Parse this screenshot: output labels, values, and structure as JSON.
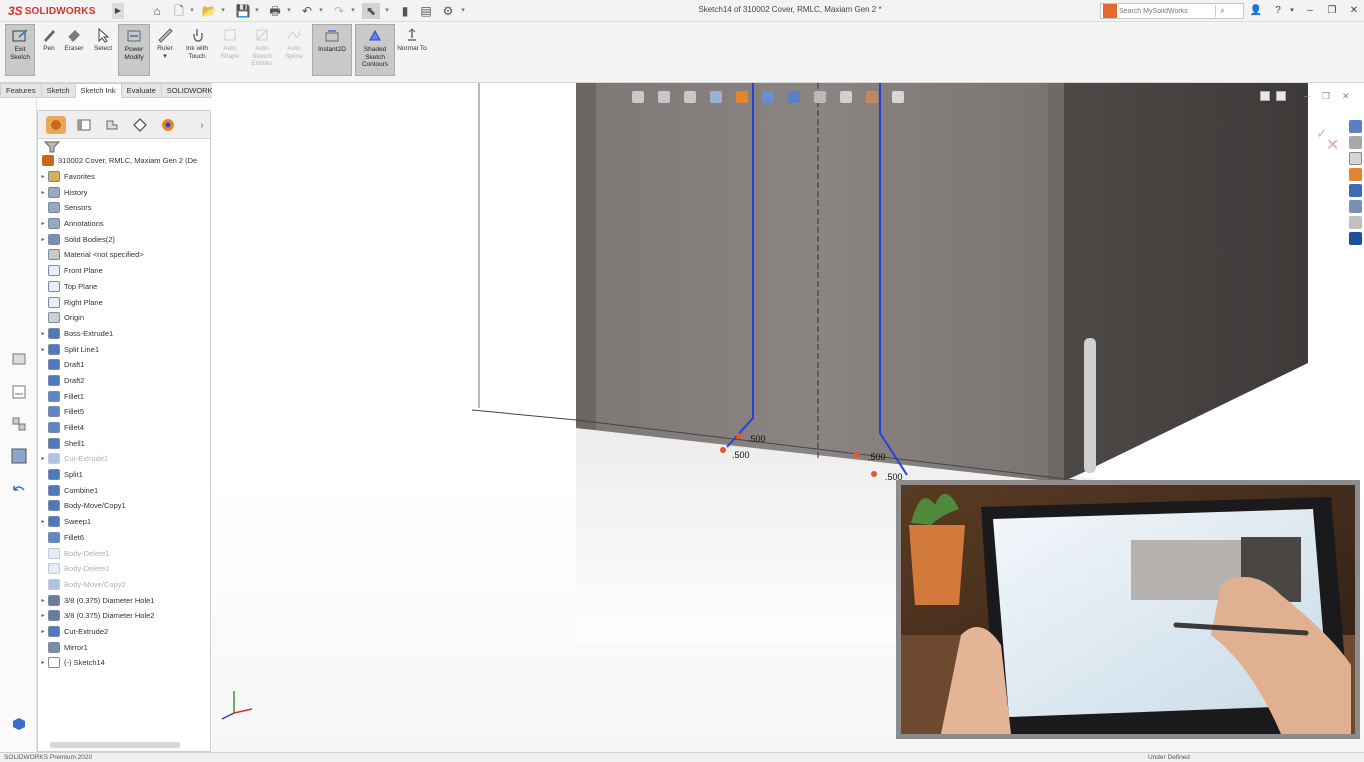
{
  "app": {
    "brand": "SOLIDWORKS",
    "document_title": "Sketch14 of 310002 Cover, RMLC, Maxiam Gen 2 *"
  },
  "titlebar": {
    "search_placeholder": "Search MySolidWorks",
    "help_label": "?",
    "icons": [
      "home-icon",
      "new-icon",
      "open-icon",
      "save-icon",
      "print-icon",
      "undo-icon",
      "redo-icon",
      "select-icon",
      "traffic-light-icon",
      "file-properties-icon",
      "options-icon"
    ]
  },
  "ribbon": {
    "buttons": [
      {
        "id": "exit-sketch",
        "label": "Exit Sketch",
        "active": true,
        "disabled": false
      },
      {
        "id": "pen",
        "label": "Pen",
        "active": false,
        "disabled": false
      },
      {
        "id": "eraser",
        "label": "Eraser",
        "active": false,
        "disabled": false
      },
      {
        "id": "select",
        "label": "Select",
        "active": false,
        "disabled": false
      },
      {
        "id": "power-modify",
        "label": "Power Modify",
        "active": true,
        "disabled": false
      },
      {
        "id": "ruler",
        "label": "Ruler",
        "active": false,
        "disabled": false
      },
      {
        "id": "ink-with-touch",
        "label": "Ink with Touch",
        "active": false,
        "disabled": false
      },
      {
        "id": "auto-shape",
        "label": "Auto Shape",
        "active": false,
        "disabled": true
      },
      {
        "id": "auto-sketch-entities",
        "label": "Auto Sketch Entities",
        "active": false,
        "disabled": true
      },
      {
        "id": "auto-spline",
        "label": "Auto Spline",
        "active": false,
        "disabled": true
      },
      {
        "id": "instant2d",
        "label": "Instant2D",
        "active": true,
        "disabled": false
      },
      {
        "id": "shaded-sketch-contours",
        "label": "Shaded Sketch Contours",
        "active": true,
        "disabled": false
      },
      {
        "id": "normal-to",
        "label": "Normal To",
        "active": false,
        "disabled": false
      }
    ]
  },
  "tabs": [
    {
      "label": "Features",
      "active": false
    },
    {
      "label": "Sketch",
      "active": false
    },
    {
      "label": "Sketch Ink",
      "active": true
    },
    {
      "label": "Evaluate",
      "active": false
    },
    {
      "label": "SOLIDWORKS Add-Ins",
      "active": false
    }
  ],
  "feature_tree": {
    "root": "310002 Cover, RMLC, Maxiam Gen 2 (De",
    "items": [
      {
        "label": "Favorites",
        "expandable": true,
        "icon": "folder-icon",
        "suppressed": false
      },
      {
        "label": "History",
        "expandable": true,
        "icon": "history-icon",
        "suppressed": false
      },
      {
        "label": "Sensors",
        "expandable": false,
        "icon": "sensor-icon",
        "suppressed": false
      },
      {
        "label": "Annotations",
        "expandable": true,
        "icon": "annotation-icon",
        "suppressed": false
      },
      {
        "label": "Solid Bodies(2)",
        "expandable": true,
        "icon": "solid-bodies-icon",
        "suppressed": false
      },
      {
        "label": "Material <not specified>",
        "expandable": false,
        "icon": "material-icon",
        "suppressed": false
      },
      {
        "label": "Front Plane",
        "expandable": false,
        "icon": "plane-icon",
        "suppressed": false
      },
      {
        "label": "Top Plane",
        "expandable": false,
        "icon": "plane-icon",
        "suppressed": false
      },
      {
        "label": "Right Plane",
        "expandable": false,
        "icon": "plane-icon",
        "suppressed": false
      },
      {
        "label": "Origin",
        "expandable": false,
        "icon": "origin-icon",
        "suppressed": false
      },
      {
        "label": "Boss-Extrude1",
        "expandable": true,
        "icon": "extrude-icon",
        "suppressed": false
      },
      {
        "label": "Split Line1",
        "expandable": true,
        "icon": "split-line-icon",
        "suppressed": false
      },
      {
        "label": "Draft1",
        "expandable": false,
        "icon": "draft-icon",
        "suppressed": false
      },
      {
        "label": "Draft2",
        "expandable": false,
        "icon": "draft-icon",
        "suppressed": false
      },
      {
        "label": "Fillet1",
        "expandable": false,
        "icon": "fillet-icon",
        "suppressed": false
      },
      {
        "label": "Fillet5",
        "expandable": false,
        "icon": "fillet-icon",
        "suppressed": false
      },
      {
        "label": "Fillet4",
        "expandable": false,
        "icon": "fillet-icon",
        "suppressed": false
      },
      {
        "label": "Shell1",
        "expandable": false,
        "icon": "shell-icon",
        "suppressed": false
      },
      {
        "label": "Cut-Extrude1",
        "expandable": true,
        "icon": "cut-extrude-icon",
        "suppressed": true
      },
      {
        "label": "Split1",
        "expandable": false,
        "icon": "split-icon",
        "suppressed": false
      },
      {
        "label": "Combine1",
        "expandable": false,
        "icon": "combine-icon",
        "suppressed": false
      },
      {
        "label": "Body-Move/Copy1",
        "expandable": false,
        "icon": "move-copy-icon",
        "suppressed": false
      },
      {
        "label": "Sweep1",
        "expandable": true,
        "icon": "sweep-icon",
        "suppressed": false
      },
      {
        "label": "Fillet6",
        "expandable": false,
        "icon": "fillet-icon",
        "suppressed": false
      },
      {
        "label": "Body-Delete1",
        "expandable": false,
        "icon": "body-delete-icon",
        "suppressed": true
      },
      {
        "label": "Body-Delete2",
        "expandable": false,
        "icon": "body-delete-icon",
        "suppressed": true
      },
      {
        "label": "Body-Move/Copy2",
        "expandable": false,
        "icon": "move-copy-icon",
        "suppressed": true
      },
      {
        "label": "3/8 (0.375) Diameter Hole1",
        "expandable": true,
        "icon": "hole-icon",
        "suppressed": false
      },
      {
        "label": "3/8 (0.375) Diameter Hole2",
        "expandable": true,
        "icon": "hole-icon",
        "suppressed": false
      },
      {
        "label": "Cut-Extrude2",
        "expandable": true,
        "icon": "cut-extrude-icon",
        "suppressed": false
      },
      {
        "label": "Mirror1",
        "expandable": false,
        "icon": "mirror-icon",
        "suppressed": false
      },
      {
        "label": "(-) Sketch14",
        "expandable": true,
        "icon": "sketch-icon",
        "suppressed": false
      }
    ]
  },
  "viewport": {
    "dimensions": [
      ".500",
      ".500",
      ".500",
      ".500"
    ],
    "sketch_line_color": "#2a3fd6",
    "part_color": "#857f7d"
  },
  "video_overlay": {
    "description_visible": false
  },
  "statusbar": {
    "product": "SOLIDWORKS Premium 2020",
    "state": "Under Defined"
  },
  "colors": {
    "brand_red": "#d8302a",
    "sketch_blue": "#2a3fd6",
    "dimension_arrow": "#e2572a"
  }
}
